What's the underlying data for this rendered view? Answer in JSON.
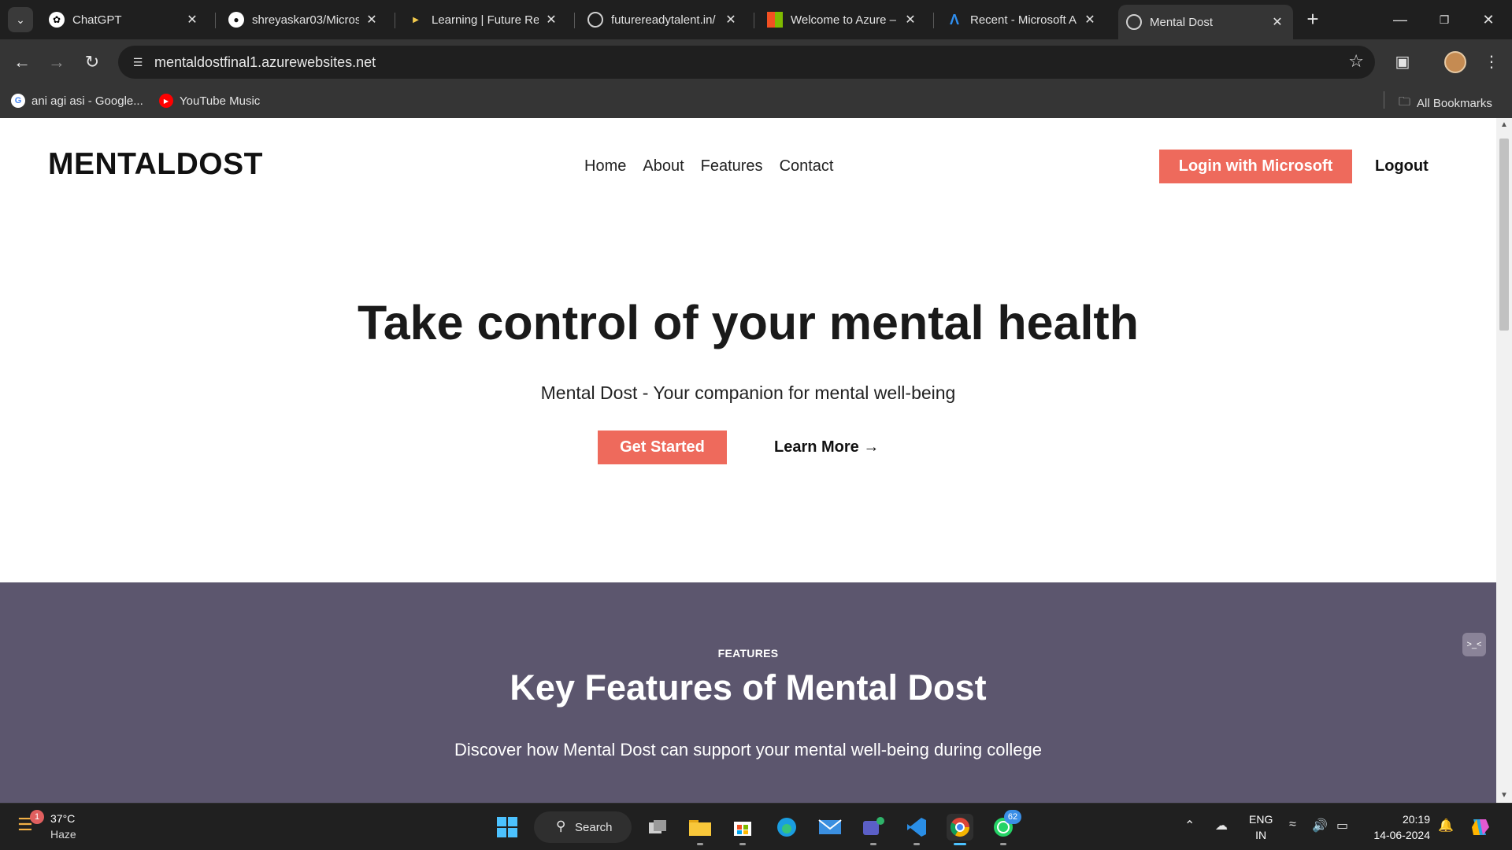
{
  "browser": {
    "tabs": [
      {
        "title": "ChatGPT",
        "icon": "chatgpt-icon"
      },
      {
        "title": "shreyaskar03/Micros",
        "icon": "github-icon"
      },
      {
        "title": "Learning | Future Rea",
        "icon": "play-icon"
      },
      {
        "title": "futurereadytalent.in/",
        "icon": "globe-icon"
      },
      {
        "title": "Welcome to Azure –",
        "icon": "microsoft-icon"
      },
      {
        "title": "Recent - Microsoft A",
        "icon": "azure-icon"
      },
      {
        "title": "Mental Dost",
        "icon": "globe-icon",
        "active": true
      }
    ],
    "url": "mentaldostfinal1.azurewebsites.net",
    "bookmarks": [
      {
        "label": "ani agi asi - Google...",
        "icon": "google-icon"
      },
      {
        "label": "YouTube Music",
        "icon": "youtube-music-icon"
      }
    ],
    "all_bookmarks": "All Bookmarks"
  },
  "page": {
    "logo": "MENTALDOST",
    "nav": [
      "Home",
      "About",
      "Features",
      "Contact"
    ],
    "login_button": "Login with Microsoft",
    "logout": "Logout",
    "hero": {
      "title": "Take control of your mental health",
      "subtitle": "Mental Dost - Your companion for mental well-being",
      "cta_primary": "Get Started",
      "cta_secondary": "Learn More →"
    },
    "features": {
      "kicker": "FEATURES",
      "title": "Key Features of Mental Dost",
      "subtitle": "Discover how Mental Dost can support your mental well-being during college"
    },
    "colors": {
      "accent": "#ee6a5c",
      "features_bg": "#5c566e",
      "text_dark": "#1a1a1a"
    }
  },
  "taskbar": {
    "weather": {
      "temp": "37°C",
      "condition": "Haze",
      "badge": "1"
    },
    "search_label": "Search",
    "whatsapp_badge": "62",
    "language": {
      "line1": "ENG",
      "line2": "IN"
    },
    "clock": {
      "time": "20:19",
      "date": "14-06-2024"
    }
  }
}
